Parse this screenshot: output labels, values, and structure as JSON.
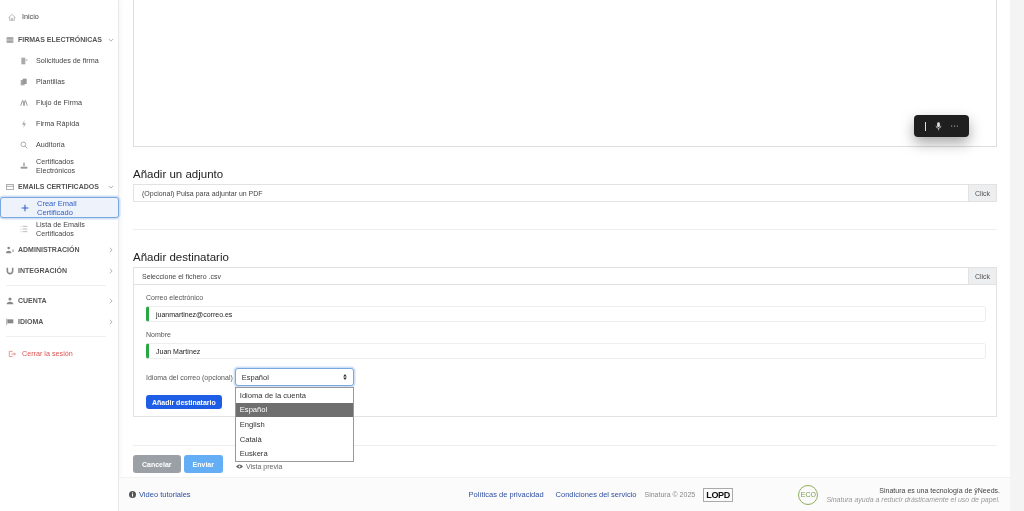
{
  "sidebar": {
    "items": [
      {
        "kind": "link",
        "label": "Inicio",
        "selected": false
      },
      {
        "kind": "section",
        "label": "FIRMAS ELECTRÓNICAS",
        "expanded": true,
        "children": [
          {
            "label": "Solicitudes de firma",
            "selected": false
          },
          {
            "label": "Plantillas",
            "selected": false
          },
          {
            "label": "Flujo de Firma",
            "selected": false
          },
          {
            "label": "Firma Rápida",
            "selected": false
          },
          {
            "label": "Auditoría",
            "selected": false
          },
          {
            "label": "Certificados Electrónicos",
            "selected": false
          }
        ]
      },
      {
        "kind": "section",
        "label": "EMAILS CERTIFICADOS",
        "expanded": true,
        "children": [
          {
            "label": "Crear Email Certificado",
            "selected": true
          },
          {
            "label": "Lista de Emails Certificados",
            "selected": false
          }
        ]
      },
      {
        "kind": "section",
        "label": "ADMINISTRACIÓN",
        "expanded": false
      },
      {
        "kind": "section",
        "label": "INTEGRACIÓN",
        "expanded": false
      },
      {
        "kind": "divider"
      },
      {
        "kind": "section",
        "label": "CUENTA",
        "expanded": false
      },
      {
        "kind": "section",
        "label": "IDIOMA",
        "expanded": false
      },
      {
        "kind": "divider"
      },
      {
        "kind": "logout",
        "label": "Cerrar la sesión",
        "selected": false
      }
    ]
  },
  "attachment": {
    "title": "Añadir un adjunto",
    "placeholder": "(Opcional) Pulsa para adjuntar un PDF",
    "button": "Click"
  },
  "recipient": {
    "title": "Añadir destinatario",
    "placeholder": "Seleccione el fichero .csv",
    "button": "Click",
    "email_label": "Correo electrónico",
    "email": "juanmartinez@correo.es",
    "name_label": "Nombre",
    "name": "Juan Martínez",
    "language_label": "Idioma del correo (opcional)",
    "language": "Español",
    "language_options": [
      {
        "label": "Idioma de la cuenta",
        "selected": false
      },
      {
        "label": "Español",
        "selected": true
      },
      {
        "label": "English",
        "selected": false
      },
      {
        "label": "Català",
        "selected": false
      },
      {
        "label": "Euskera",
        "selected": false
      }
    ],
    "add_button": "Añadir destinatario"
  },
  "actions": [
    {
      "kind": "cancel",
      "label": "Cancelar"
    },
    {
      "kind": "send",
      "label": "Enviar"
    },
    {
      "kind": "preview",
      "label": "Vista previa"
    }
  ],
  "footer": {
    "tutorials": "Video tutoriales",
    "links": [
      "Políticas de privacidad",
      "Condiciones del servicio"
    ],
    "copyright": "Sinatura © 2025",
    "lopd": "LOPD",
    "eco": "ECO",
    "tagline": "Sinatura es una tecnología de ÿNeeds.",
    "subtagline": "Sinatura ayuda a reducir drásticamente el uso de papel."
  }
}
